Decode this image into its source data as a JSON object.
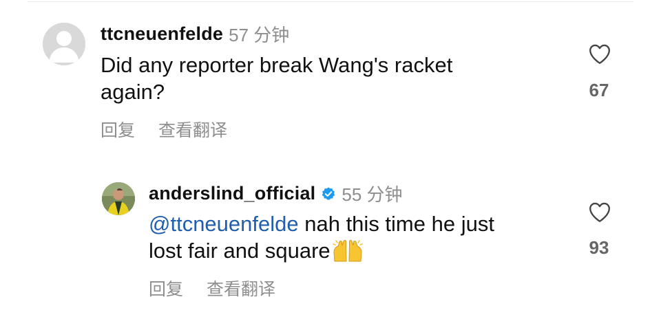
{
  "comments": [
    {
      "username": "ttcneuenfelde",
      "time": "57 分钟",
      "text_line1": "Did any reporter break Wang's racket",
      "text_line2": "again?",
      "reply_label": "回复",
      "translate_label": "查看翻译",
      "likes": "67"
    },
    {
      "username": "anderslind_official",
      "verified": true,
      "time": "55 分钟",
      "mention": "@ttcneuenfelde",
      "text_line1_rest": " nah this time he just",
      "text_line2": "lost fair and square",
      "emoji": "raising-hands",
      "reply_label": "回复",
      "translate_label": "查看翻译",
      "likes": "93"
    }
  ],
  "colors": {
    "text": "#111111",
    "muted": "#8e8e8e",
    "mention": "#1f5fae",
    "verified": "#1d9bf0"
  }
}
